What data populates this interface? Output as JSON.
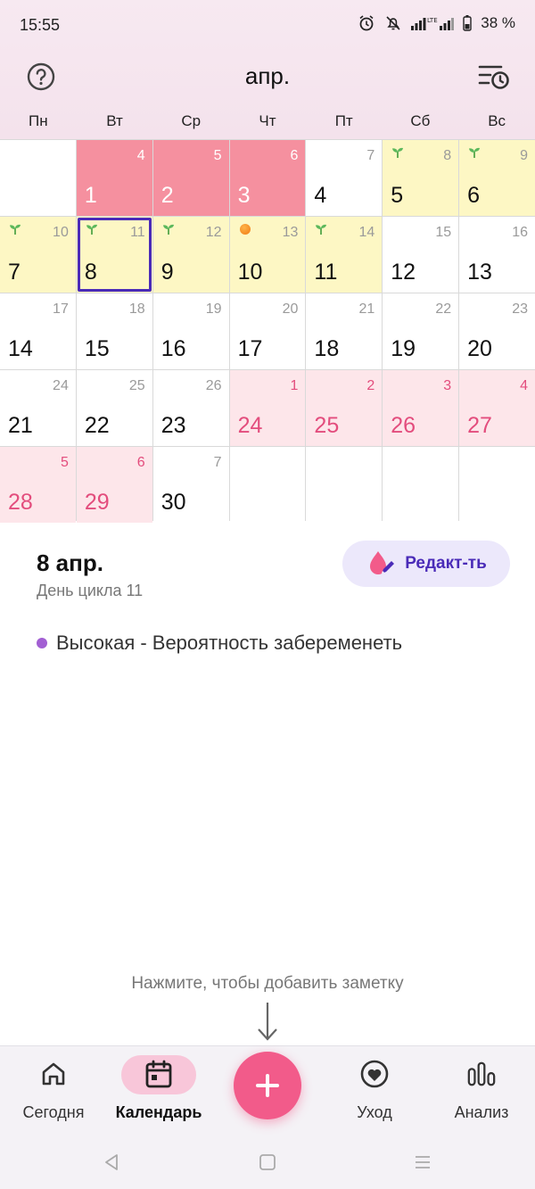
{
  "status": {
    "time": "15:55",
    "battery": "38 %",
    "network": "LTE"
  },
  "header": {
    "month": "апр."
  },
  "weekdays": [
    "Пн",
    "Вт",
    "Ср",
    "Чт",
    "Пт",
    "Сб",
    "Вс"
  ],
  "calendar": {
    "days": [
      {
        "day": "",
        "cycle": "",
        "state": "empty",
        "marker": ""
      },
      {
        "day": "1",
        "cycle": "4",
        "state": "period",
        "marker": ""
      },
      {
        "day": "2",
        "cycle": "5",
        "state": "period",
        "marker": ""
      },
      {
        "day": "3",
        "cycle": "6",
        "state": "period",
        "marker": ""
      },
      {
        "day": "4",
        "cycle": "7",
        "state": "normal",
        "marker": ""
      },
      {
        "day": "5",
        "cycle": "8",
        "state": "fertile",
        "marker": "sprout"
      },
      {
        "day": "6",
        "cycle": "9",
        "state": "fertile",
        "marker": "sprout"
      },
      {
        "day": "7",
        "cycle": "10",
        "state": "fertile",
        "marker": "sprout"
      },
      {
        "day": "8",
        "cycle": "11",
        "state": "fertile",
        "marker": "sprout",
        "selected": true
      },
      {
        "day": "9",
        "cycle": "12",
        "state": "fertile",
        "marker": "sprout"
      },
      {
        "day": "10",
        "cycle": "13",
        "state": "fertile",
        "marker": "egg"
      },
      {
        "day": "11",
        "cycle": "14",
        "state": "fertile",
        "marker": "sprout"
      },
      {
        "day": "12",
        "cycle": "15",
        "state": "normal",
        "marker": ""
      },
      {
        "day": "13",
        "cycle": "16",
        "state": "normal",
        "marker": ""
      },
      {
        "day": "14",
        "cycle": "17",
        "state": "normal",
        "marker": ""
      },
      {
        "day": "15",
        "cycle": "18",
        "state": "normal",
        "marker": ""
      },
      {
        "day": "16",
        "cycle": "19",
        "state": "normal",
        "marker": ""
      },
      {
        "day": "17",
        "cycle": "20",
        "state": "normal",
        "marker": ""
      },
      {
        "day": "18",
        "cycle": "21",
        "state": "normal",
        "marker": ""
      },
      {
        "day": "19",
        "cycle": "22",
        "state": "normal",
        "marker": ""
      },
      {
        "day": "20",
        "cycle": "23",
        "state": "normal",
        "marker": ""
      },
      {
        "day": "21",
        "cycle": "24",
        "state": "normal",
        "marker": ""
      },
      {
        "day": "22",
        "cycle": "25",
        "state": "normal",
        "marker": ""
      },
      {
        "day": "23",
        "cycle": "26",
        "state": "normal",
        "marker": ""
      },
      {
        "day": "24",
        "cycle": "1",
        "state": "predicted",
        "marker": ""
      },
      {
        "day": "25",
        "cycle": "2",
        "state": "predicted",
        "marker": ""
      },
      {
        "day": "26",
        "cycle": "3",
        "state": "predicted",
        "marker": ""
      },
      {
        "day": "27",
        "cycle": "4",
        "state": "predicted",
        "marker": ""
      },
      {
        "day": "28",
        "cycle": "5",
        "state": "predicted",
        "marker": ""
      },
      {
        "day": "29",
        "cycle": "6",
        "state": "predicted",
        "marker": ""
      },
      {
        "day": "30",
        "cycle": "7",
        "state": "normal",
        "marker": ""
      },
      {
        "day": "",
        "cycle": "",
        "state": "empty",
        "marker": ""
      },
      {
        "day": "",
        "cycle": "",
        "state": "empty",
        "marker": ""
      },
      {
        "day": "",
        "cycle": "",
        "state": "empty",
        "marker": ""
      },
      {
        "day": "",
        "cycle": "",
        "state": "empty",
        "marker": ""
      }
    ]
  },
  "details": {
    "date": "8 апр.",
    "cycle_day": "День цикла 11",
    "edit_label": "Редакт-ть",
    "fertility": "Высокая - Вероятность забеременеть"
  },
  "note_hint": "Нажмите, чтобы добавить заметку",
  "nav": {
    "today": "Сегодня",
    "calendar": "Календарь",
    "care": "Уход",
    "analysis": "Анализ"
  },
  "colors": {
    "period": "#f5909f",
    "fertile": "#fdf7c4",
    "predicted": "#fde6ea",
    "accent": "#f25b8a",
    "selected_border": "#4a2bb8"
  }
}
